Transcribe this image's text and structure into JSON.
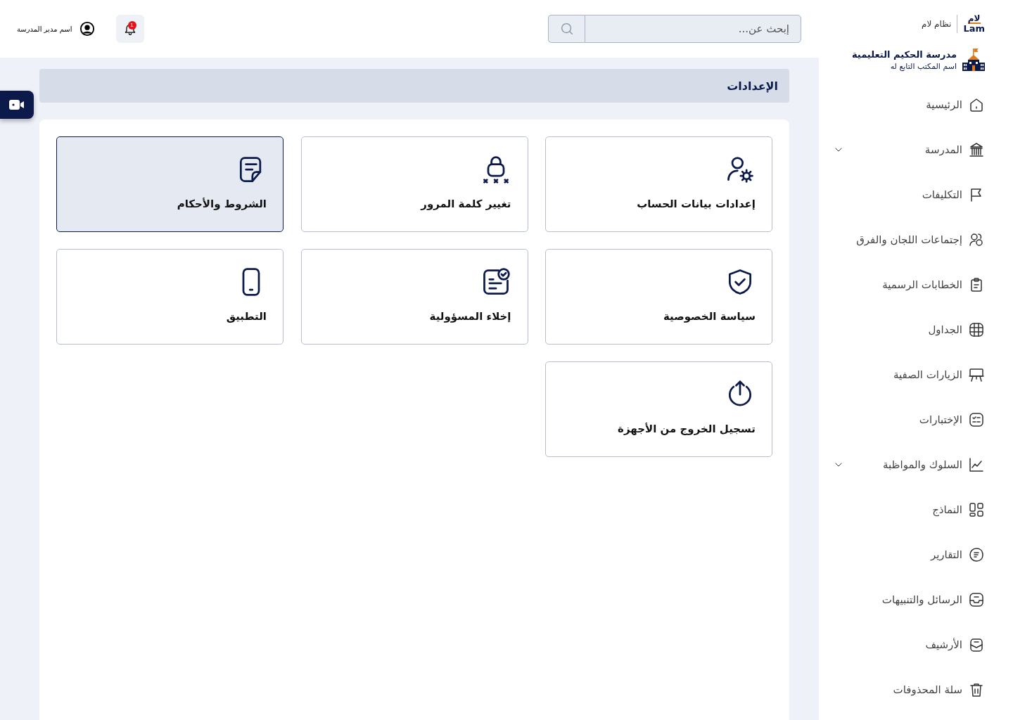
{
  "sidebar": {
    "logo": {
      "arabic": "لام",
      "latin": "Lam",
      "caption": "نظام لام"
    },
    "school": {
      "name": "مدرسة الحكيم التعليمية",
      "office": "اسم المكتب التابع له"
    },
    "items": [
      {
        "label": "الرئيسية",
        "expandable": false
      },
      {
        "label": "المدرسة",
        "expandable": true
      },
      {
        "label": "التكليفات",
        "expandable": false
      },
      {
        "label": "إجتماعات اللجان والفرق",
        "expandable": false
      },
      {
        "label": "الخطابات الرسمية",
        "expandable": false
      },
      {
        "label": "الجداول",
        "expandable": false
      },
      {
        "label": "الزيارات الصفية",
        "expandable": false
      },
      {
        "label": "الإختبارات",
        "expandable": false
      },
      {
        "label": "السلوك والمواظبة",
        "expandable": true
      },
      {
        "label": "النماذج",
        "expandable": false
      },
      {
        "label": "التقارير",
        "expandable": false
      },
      {
        "label": "الرسائل والتنبيهات",
        "expandable": false
      },
      {
        "label": "الأرشيف",
        "expandable": false
      },
      {
        "label": "سلة المحذوفات",
        "expandable": false
      }
    ]
  },
  "header": {
    "search": {
      "placeholder": "إبحث عن..."
    },
    "notifications": {
      "count": "1"
    },
    "user": {
      "name": "اسم مدير المدرسة"
    }
  },
  "page": {
    "title": "الإعدادات",
    "cards": [
      {
        "label": "إعدادات بيانات الحساب",
        "selected": false
      },
      {
        "label": "تغيير كلمة المرور",
        "selected": false
      },
      {
        "label": "الشروط والأحكام",
        "selected": true
      },
      {
        "label": "سياسة الخصوصية",
        "selected": false
      },
      {
        "label": "إخلاء المسؤولية",
        "selected": false
      },
      {
        "label": "التطبيق",
        "selected": false
      },
      {
        "label": "تسجيل الخروج من الأجهزة",
        "selected": false
      }
    ]
  }
}
